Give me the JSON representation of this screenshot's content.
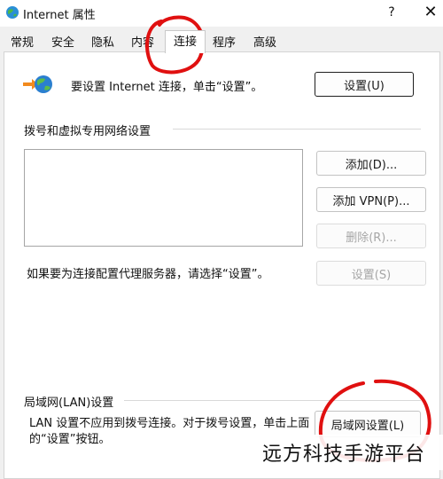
{
  "window": {
    "title": "Internet 属性",
    "help_glyph": "?",
    "close_glyph": "✕"
  },
  "tabs": [
    {
      "label": "常规"
    },
    {
      "label": "安全"
    },
    {
      "label": "隐私"
    },
    {
      "label": "内容"
    },
    {
      "label": "连接",
      "active": true
    },
    {
      "label": "程序"
    },
    {
      "label": "高级"
    }
  ],
  "connection": {
    "setup_text": "要设置 Internet 连接，单击“设置”。",
    "setup_button": "设置(U)",
    "dialup_section_label": "拨号和虚拟专用网络设置",
    "add_button": "添加(D)...",
    "add_vpn_button": "添加 VPN(P)...",
    "remove_button": "删除(R)...",
    "proxy_text": "如果要为连接配置代理服务器，请选择“设置”。",
    "settings_button": "设置(S)",
    "lan_section_label": "局域网(LAN)设置",
    "lan_text": "LAN 设置不应用到拨号连接。对于拨号设置，单击上面的“设置”按钮。",
    "lan_button": "局域网设置(L)"
  },
  "watermark": {
    "text": "远方科技手游平台"
  },
  "colors": {
    "panel": "#ffffff",
    "background": "#f0f0f0",
    "annotation": "#e01010"
  }
}
